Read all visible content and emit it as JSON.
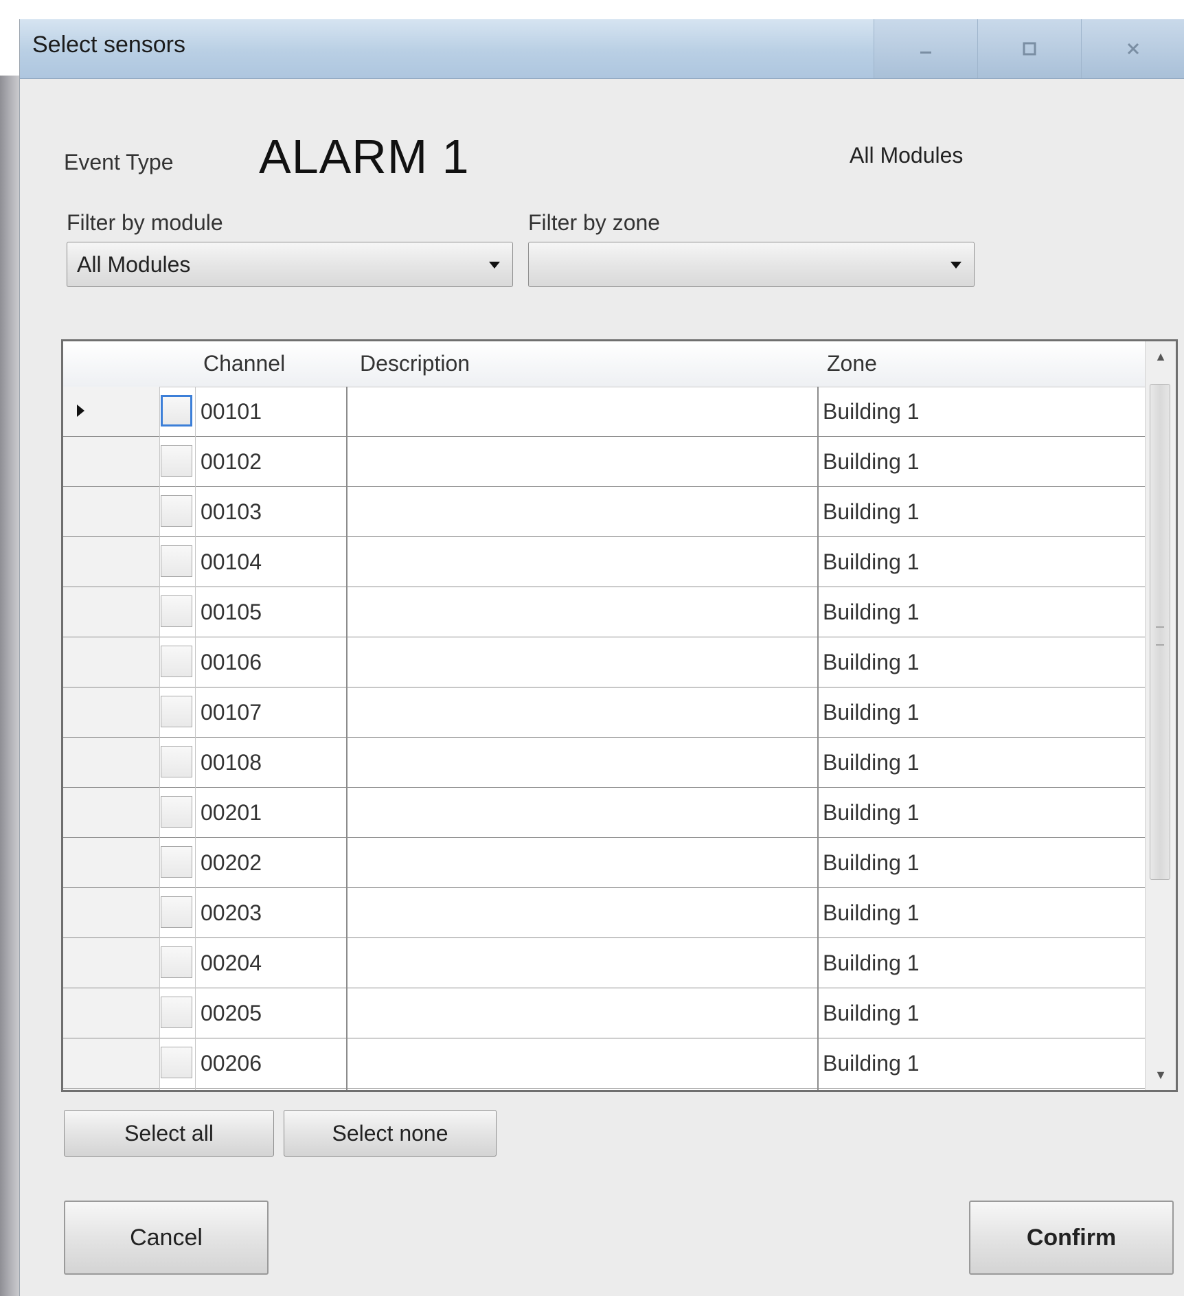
{
  "window": {
    "title": "Select sensors",
    "controls": [
      "minimize-icon",
      "maximize-icon",
      "close-icon"
    ]
  },
  "header": {
    "event_type_label": "Event Type",
    "event_type_value": "ALARM 1",
    "module_label": "All Modules"
  },
  "filters": {
    "module": {
      "label": "Filter by module",
      "value": "All Modules"
    },
    "zone": {
      "label": "Filter by zone",
      "value": ""
    }
  },
  "grid": {
    "columns": [
      "Channel",
      "Description",
      "Zone"
    ],
    "rows": [
      {
        "channel": "00101",
        "description": "",
        "zone": "Building 1",
        "checked": false,
        "current": true
      },
      {
        "channel": "00102",
        "description": "",
        "zone": "Building 1",
        "checked": false
      },
      {
        "channel": "00103",
        "description": "",
        "zone": "Building 1",
        "checked": false
      },
      {
        "channel": "00104",
        "description": "",
        "zone": "Building 1",
        "checked": false
      },
      {
        "channel": "00105",
        "description": "",
        "zone": "Building 1",
        "checked": false
      },
      {
        "channel": "00106",
        "description": "",
        "zone": "Building 1",
        "checked": false
      },
      {
        "channel": "00107",
        "description": "",
        "zone": "Building 1",
        "checked": false
      },
      {
        "channel": "00108",
        "description": "",
        "zone": "Building 1",
        "checked": false
      },
      {
        "channel": "00201",
        "description": "",
        "zone": "Building 1",
        "checked": false
      },
      {
        "channel": "00202",
        "description": "",
        "zone": "Building 1",
        "checked": false
      },
      {
        "channel": "00203",
        "description": "",
        "zone": "Building 1",
        "checked": false
      },
      {
        "channel": "00204",
        "description": "",
        "zone": "Building 1",
        "checked": false
      },
      {
        "channel": "00205",
        "description": "",
        "zone": "Building 1",
        "checked": false
      },
      {
        "channel": "00206",
        "description": "",
        "zone": "Building 1",
        "checked": false
      }
    ]
  },
  "buttons": {
    "select_all": "Select all",
    "select_none": "Select none",
    "cancel": "Cancel",
    "confirm": "Confirm"
  }
}
